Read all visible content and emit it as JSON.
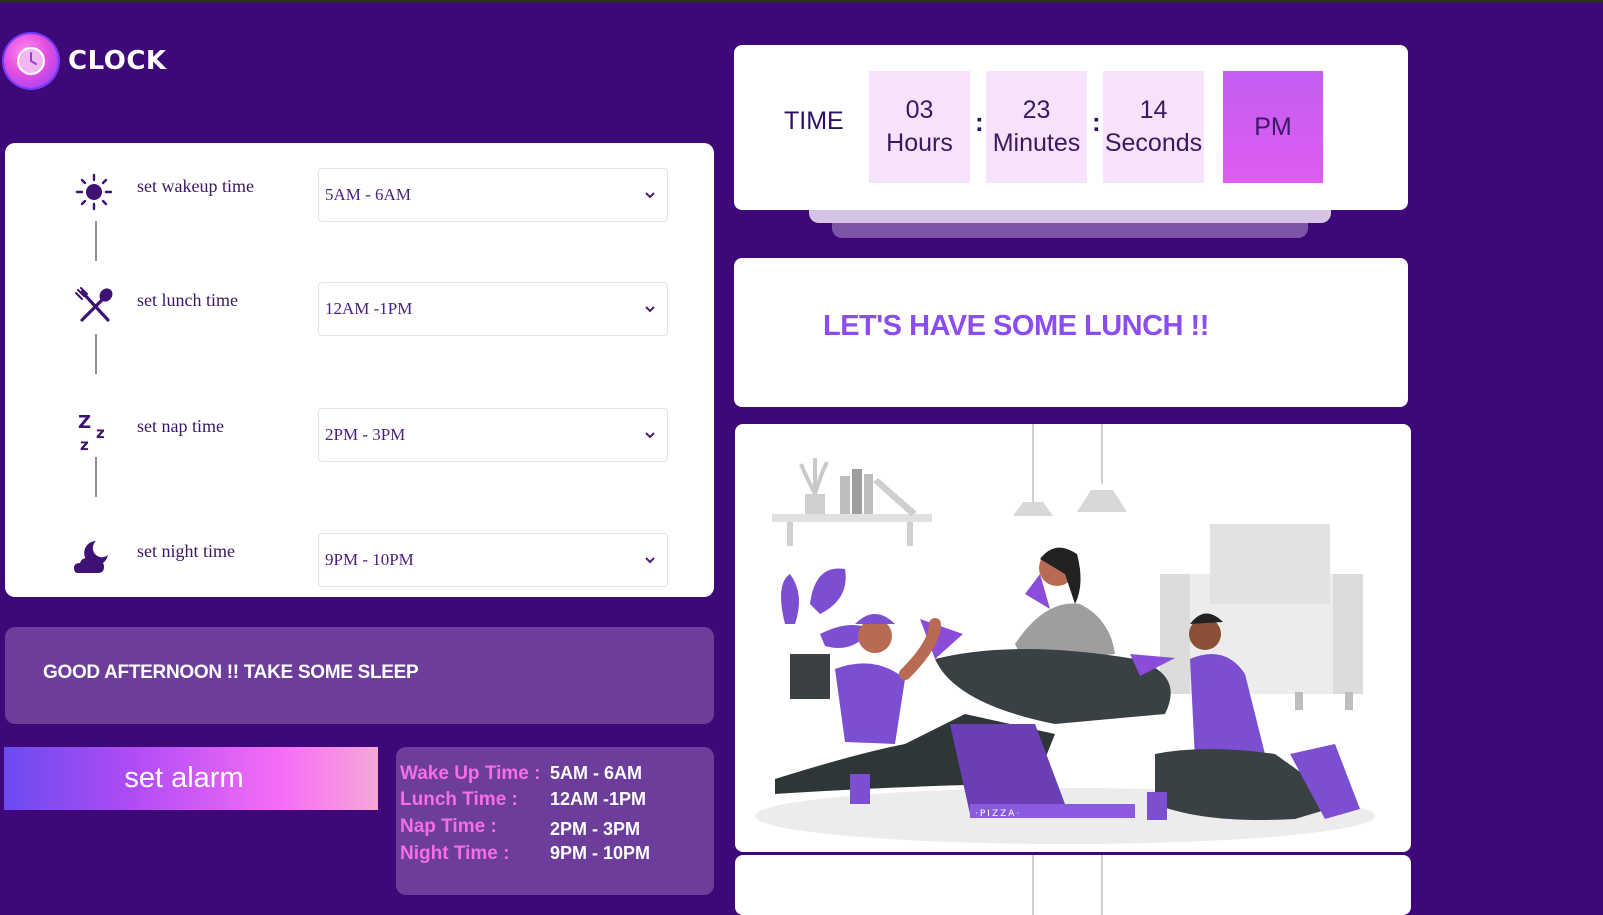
{
  "app": {
    "title": "CLOCK"
  },
  "settings": {
    "rows": [
      {
        "label": "set wakeup time",
        "value": "5AM - 6AM",
        "icon": "sun-icon"
      },
      {
        "label": "set lunch time",
        "value": "12AM -1PM",
        "icon": "fork-spoon-icon"
      },
      {
        "label": "set nap time",
        "value": "2PM - 3PM",
        "icon": "sleep-zzz-icon"
      },
      {
        "label": "set night time",
        "value": "9PM - 10PM",
        "icon": "moon-cloud-icon"
      }
    ]
  },
  "greeting": "GOOD AFTERNOON !! TAKE SOME SLEEP",
  "alarm_button": "set alarm",
  "summary": [
    {
      "label": "Wake Up Time :",
      "value": "5AM - 6AM"
    },
    {
      "label": "Lunch Time :",
      "value": "12AM -1PM"
    },
    {
      "label": "Nap Time :",
      "value": "2PM - 3PM"
    },
    {
      "label": "Night Time :",
      "value": "9PM - 10PM"
    }
  ],
  "clock": {
    "label": "TIME",
    "hours": "03",
    "hours_label": "Hours",
    "minutes": "23",
    "minutes_label": "Minutes",
    "seconds": "14",
    "seconds_label": "Seconds",
    "separator": ":",
    "ampm": "PM"
  },
  "message": "LET'S HAVE SOME LUNCH !!",
  "colors": {
    "background": "#3f0878",
    "panel_purple": "#6c3d9b",
    "accent_pink": "#f66ce9",
    "message_purple": "#8b4cf2"
  }
}
